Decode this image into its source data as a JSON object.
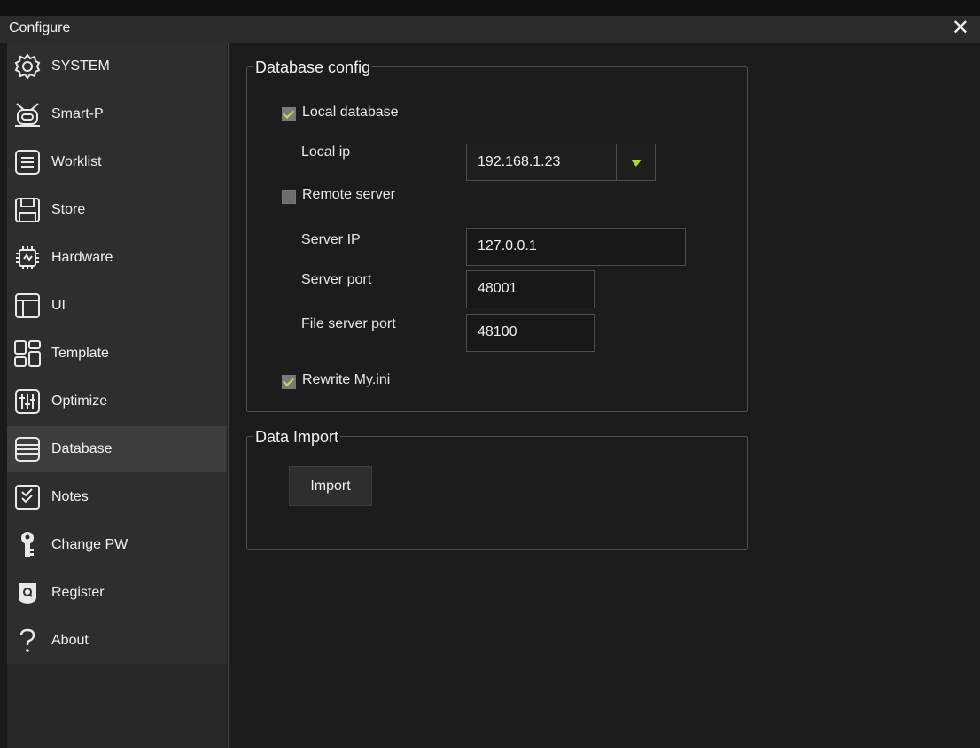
{
  "window": {
    "title": "Configure",
    "close_symbol": "✕"
  },
  "sidebar": {
    "items": [
      {
        "label": "SYSTEM",
        "icon": "gear-icon"
      },
      {
        "label": "Smart-P",
        "icon": "robot-icon"
      },
      {
        "label": "Worklist",
        "icon": "list-icon"
      },
      {
        "label": "Store",
        "icon": "save-icon"
      },
      {
        "label": "Hardware",
        "icon": "chip-icon"
      },
      {
        "label": "UI",
        "icon": "layout-icon"
      },
      {
        "label": "Template",
        "icon": "template-icon"
      },
      {
        "label": "Optimize",
        "icon": "sliders-icon"
      },
      {
        "label": "Database",
        "icon": "database-icon",
        "active": true
      },
      {
        "label": "Notes",
        "icon": "notes-icon"
      },
      {
        "label": "Change PW",
        "icon": "key-icon"
      },
      {
        "label": "Register",
        "icon": "register-icon"
      },
      {
        "label": "About",
        "icon": "question-icon"
      }
    ]
  },
  "database_config": {
    "title": "Database config",
    "local_database": {
      "label": "Local database",
      "checked": true
    },
    "local_ip": {
      "label": "Local ip",
      "value": "192.168.1.23"
    },
    "remote_server": {
      "label": "Remote server",
      "checked": false
    },
    "server_ip": {
      "label": "Server IP",
      "value": "127.0.0.1"
    },
    "server_port": {
      "label": "Server port",
      "value": "48001"
    },
    "file_server_port": {
      "label": "File server port",
      "value": "48100"
    },
    "rewrite": {
      "label": "Rewrite My.ini",
      "checked": true
    }
  },
  "data_import": {
    "title": "Data Import",
    "import_button": "Import"
  },
  "colors": {
    "accent": "#a8d82b",
    "background": "#1c1c1c",
    "sidebar": "#2e2e2e",
    "active": "#3d3d3d"
  }
}
